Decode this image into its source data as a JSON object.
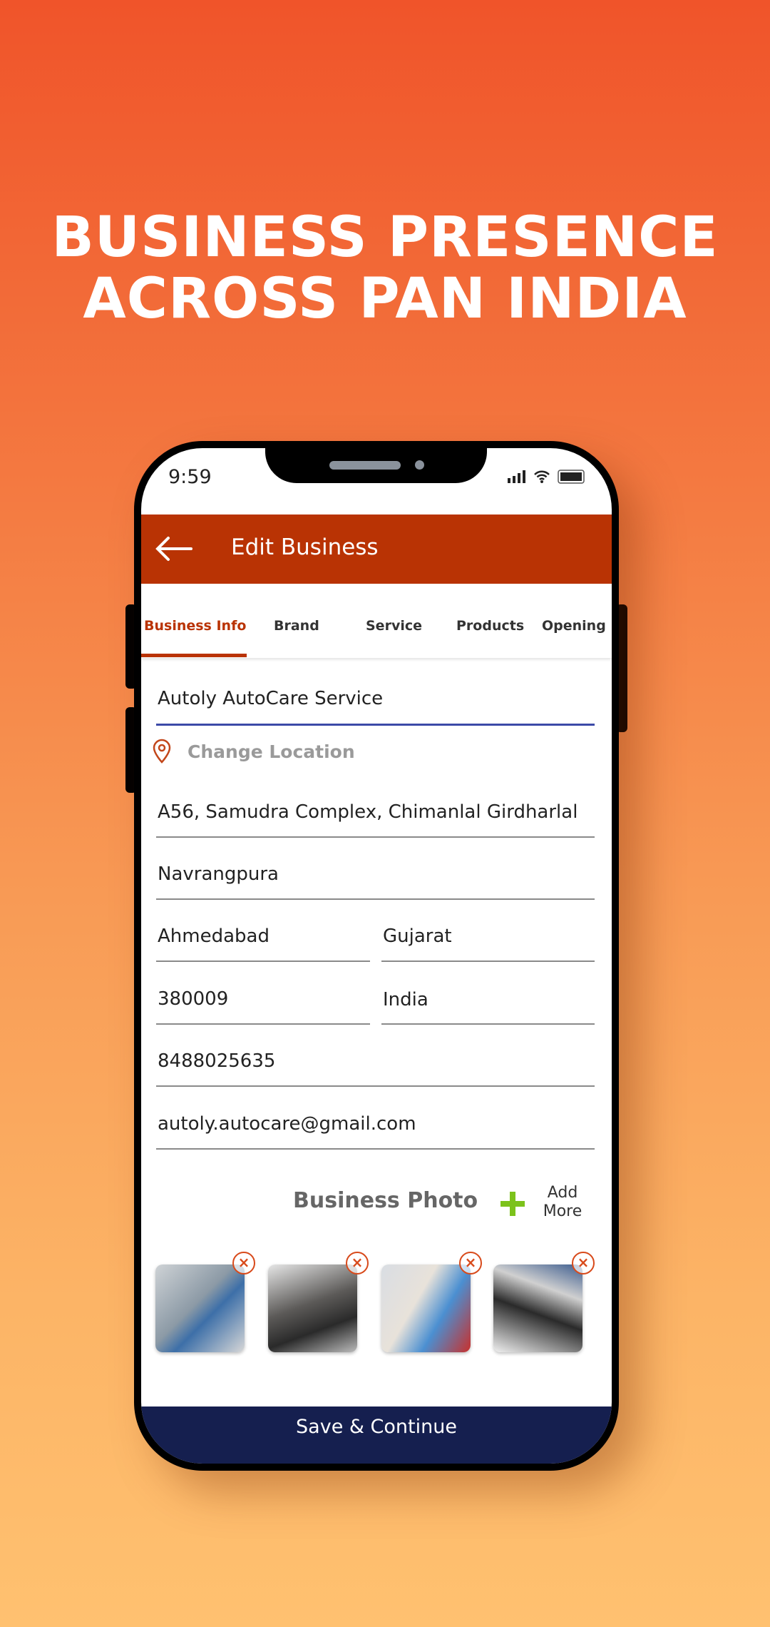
{
  "headline": {
    "line1": "BUSINESS PRESENCE",
    "line2": "ACROSS PAN INDIA"
  },
  "status_bar": {
    "time": "9:59"
  },
  "app_bar": {
    "title": "Edit Business"
  },
  "tabs": [
    {
      "label": "Business Info",
      "active": true
    },
    {
      "label": "Brand"
    },
    {
      "label": "Service"
    },
    {
      "label": "Products"
    },
    {
      "label": "Opening"
    }
  ],
  "form": {
    "business_name": "Autoly AutoCare Service",
    "change_location": "Change Location",
    "address_line1": "A56, Samudra Complex, Chimanlal Girdharlal",
    "address_line2": "Navrangpura",
    "city": "Ahmedabad",
    "state": "Gujarat",
    "pincode": "380009",
    "country": "India",
    "phone": "8488025635",
    "email": "autoly.autocare@gmail.com"
  },
  "photos": {
    "heading": "Business Photo",
    "add_more": "Add More",
    "items": [
      "garage-lift",
      "tyre-service",
      "car-polishing",
      "engine-repair"
    ]
  },
  "save_button": "Save & Continue",
  "colors": {
    "accent": "#b93304",
    "button": "#151f4f",
    "add": "#7cc21b",
    "focus": "#3c4aa8"
  }
}
